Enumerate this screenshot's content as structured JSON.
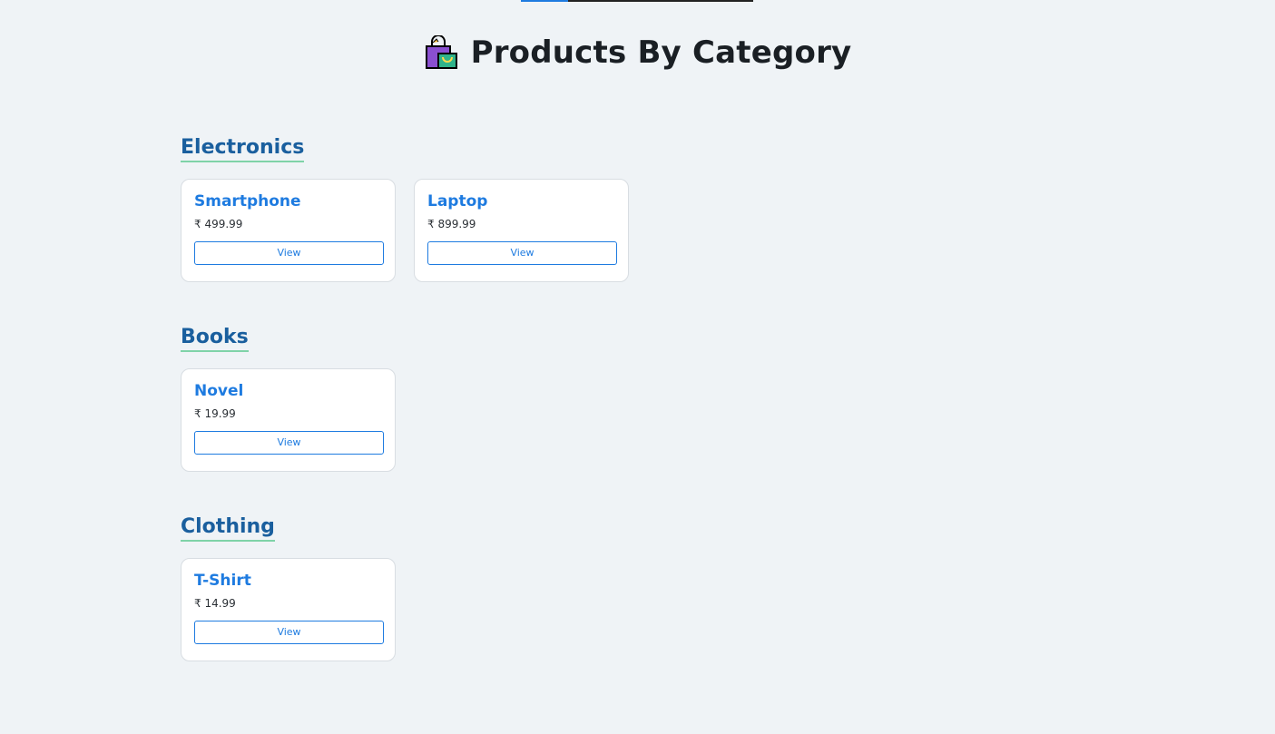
{
  "header": {
    "title": "Products By Category",
    "icon": "shopping-bags-icon"
  },
  "categories": [
    {
      "name": "Electronics",
      "products": [
        {
          "name": "Smartphone",
          "price": "₹ 499.99",
          "button": "View"
        },
        {
          "name": "Laptop",
          "price": "₹ 899.99",
          "button": "View"
        }
      ]
    },
    {
      "name": "Books",
      "products": [
        {
          "name": "Novel",
          "price": "₹ 19.99",
          "button": "View"
        }
      ]
    },
    {
      "name": "Clothing",
      "products": [
        {
          "name": "T-Shirt",
          "price": "₹ 14.99",
          "button": "View"
        }
      ]
    }
  ],
  "colors": {
    "accent": "#1e7be0",
    "category_title": "#1a5f9e",
    "category_underline": "#7fd3a8",
    "background": "#eff3f6"
  }
}
